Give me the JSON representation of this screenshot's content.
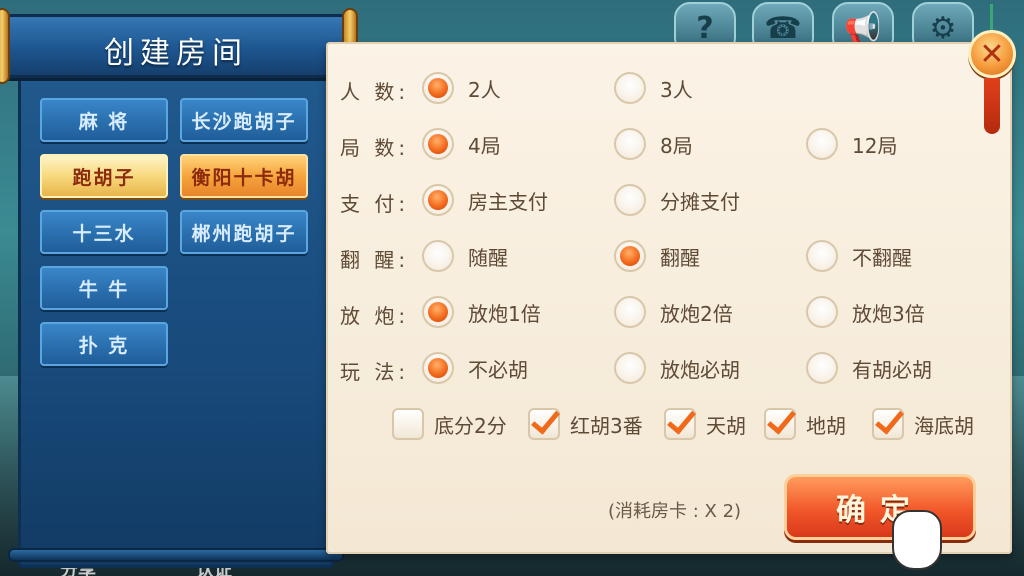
{
  "panel": {
    "title": "创建房间",
    "games": [
      {
        "label": "麻 将",
        "state": "normal"
      },
      {
        "label": "长沙跑胡子",
        "state": "normal"
      },
      {
        "label": "跑胡子",
        "state": "selected"
      },
      {
        "label": "衡阳十卡胡",
        "state": "active"
      },
      {
        "label": "十三水",
        "state": "normal"
      },
      {
        "label": "郴州跑胡子",
        "state": "normal"
      },
      {
        "label": "牛 牛",
        "state": "normal"
      },
      {
        "label": "扑 克",
        "state": "normal"
      }
    ]
  },
  "top_icons": [
    "help-icon",
    "phone-icon",
    "megaphone-icon",
    "gear-icon"
  ],
  "options": [
    {
      "label": "人 数:",
      "choices": [
        "2人",
        "3人"
      ],
      "selected": 0
    },
    {
      "label": "局 数:",
      "choices": [
        "4局",
        "8局",
        "12局"
      ],
      "selected": 0
    },
    {
      "label": "支 付:",
      "choices": [
        "房主支付",
        "分摊支付"
      ],
      "selected": 0
    },
    {
      "label": "翻 醒:",
      "choices": [
        "随醒",
        "翻醒",
        "不翻醒"
      ],
      "selected": 1
    },
    {
      "label": "放 炮:",
      "choices": [
        "放炮1倍",
        "放炮2倍",
        "放炮3倍"
      ],
      "selected": 0
    },
    {
      "label": "玩 法:",
      "choices": [
        "不必胡",
        "放炮必胡",
        "有胡必胡"
      ],
      "selected": 0
    }
  ],
  "checkboxes": [
    {
      "label": "底分2分",
      "checked": false
    },
    {
      "label": "红胡3番",
      "checked": true
    },
    {
      "label": "天胡",
      "checked": true
    },
    {
      "label": "地胡",
      "checked": true
    },
    {
      "label": "海底胡",
      "checked": true
    }
  ],
  "cost_text": "(消耗房卡 : X 2)",
  "confirm_label": "确定",
  "close_symbol": "✕",
  "background_text": [
    "分享",
    "认证"
  ],
  "colors": {
    "accent": "#f36a1d",
    "panel_blue": "#1e5690",
    "paper": "#fbf3e6"
  }
}
